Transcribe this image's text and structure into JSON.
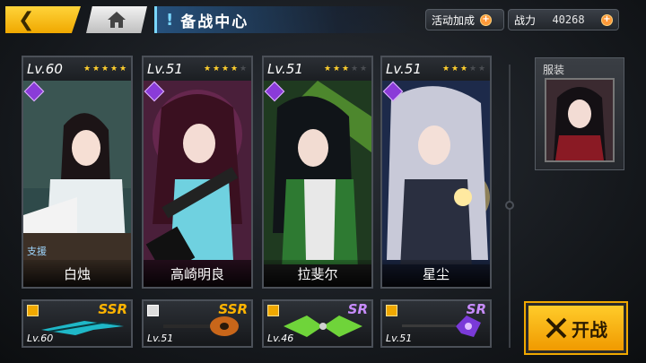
{
  "header": {
    "back_icon": "chevron-left-icon",
    "home_icon": "home-icon",
    "title": "备战中心",
    "event_bonus_label": "活动加成",
    "power_label": "战力",
    "power_value": "40268"
  },
  "cards": [
    {
      "level": "Lv.60",
      "stars_on": 5,
      "name": "白烛",
      "tag": "支援"
    },
    {
      "level": "Lv.51",
      "stars_on": 4,
      "name": "高崎明良",
      "tag": ""
    },
    {
      "level": "Lv.51",
      "stars_on": 3,
      "name": "拉斐尔",
      "tag": ""
    },
    {
      "level": "Lv.51",
      "stars_on": 3,
      "name": "星尘",
      "tag": ""
    }
  ],
  "weapons": [
    {
      "rarity": "SSR",
      "level": "Lv.60"
    },
    {
      "rarity": "SSR",
      "level": "Lv.51"
    },
    {
      "rarity": "SR",
      "level": "Lv.46"
    },
    {
      "rarity": "SR",
      "level": "Lv.51"
    }
  ],
  "outfit": {
    "label": "服装"
  },
  "start_button": {
    "label": "开战"
  },
  "colors": {
    "accent": "#f0a800",
    "title_blue": "#7ad7ff",
    "ssr": "#ffb400",
    "sr": "#c88cff"
  }
}
